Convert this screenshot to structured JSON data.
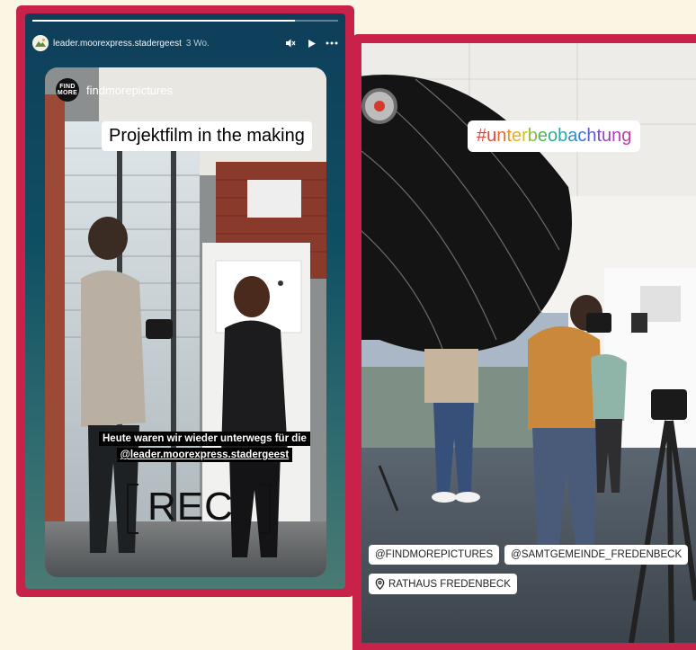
{
  "left_story": {
    "progress_fraction": 0.86,
    "header": {
      "username": "leader.moorexpress.stadergeest",
      "time": "3 Wo."
    },
    "shared_post": {
      "author": "findmorepictures",
      "logo_text_top": "FIND",
      "logo_text_bottom": "MORE"
    },
    "title_sticker": "Projektfilm in the making",
    "caption_line1": "Heute waren wir wieder unterwegs für die",
    "caption_line2": "@leader.moorexpress.stadergeest",
    "rec_text": "REC"
  },
  "right_story": {
    "hashtag_text": "#unterbeobachtung",
    "hashtag_letters": [
      "#",
      "u",
      "n",
      "t",
      "e",
      "r",
      "b",
      "e",
      "o",
      "b",
      "a",
      "c",
      "h",
      "t",
      "u",
      "n",
      "g"
    ],
    "hashtag_colors": [
      "#e0463a",
      "#e0463a",
      "#e86a2a",
      "#ee8f20",
      "#e7b21a",
      "#c9c02a",
      "#8bbf3a",
      "#4fb55a",
      "#2fb08a",
      "#2aa6b0",
      "#2a8fd0",
      "#3a74d8",
      "#5a5ad8",
      "#7a48cf",
      "#9a42c4",
      "#b63fb5",
      "#c83c9a"
    ],
    "tags": [
      "@FINDMOREPICTURES",
      "@SAMTGEMEINDE_FREDENBECK"
    ],
    "location_tag": "RATHAUS FREDENBECK"
  }
}
